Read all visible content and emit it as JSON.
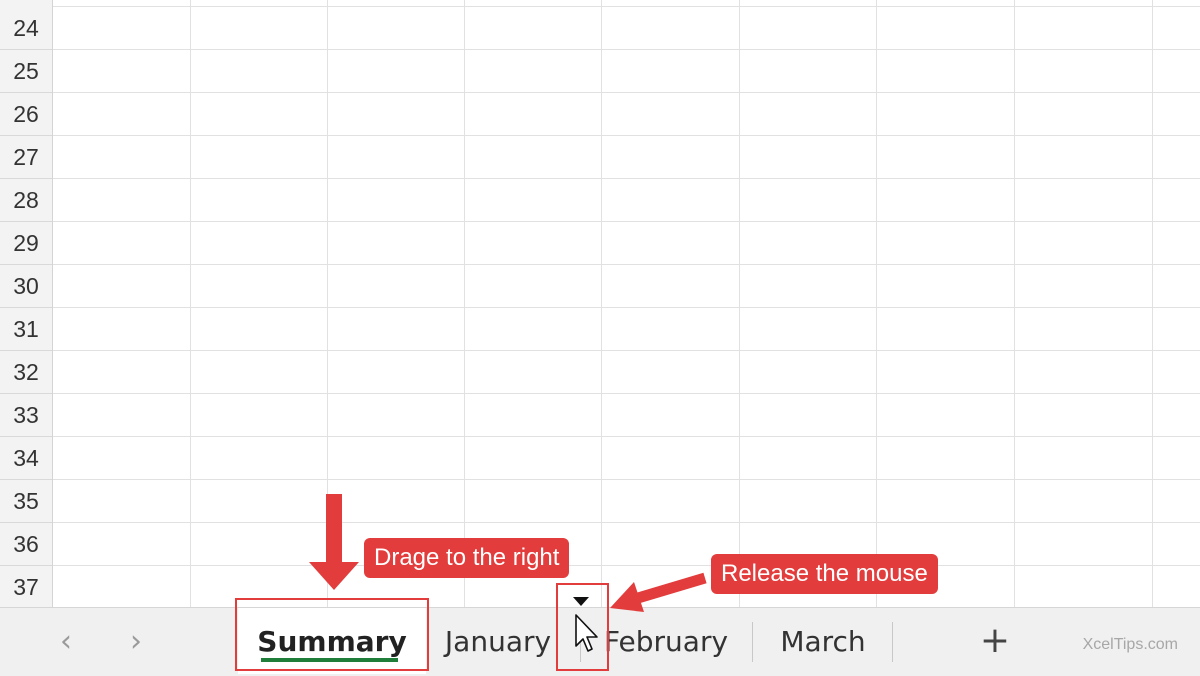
{
  "rows": [
    "24",
    "25",
    "26",
    "27",
    "28",
    "29",
    "30",
    "31",
    "32",
    "33",
    "34",
    "35",
    "36",
    "37"
  ],
  "sheet_tabs": {
    "nav_prev": "‹",
    "nav_next": "›",
    "tabs": [
      {
        "label": "Summary",
        "active": true
      },
      {
        "label": "January",
        "active": false
      },
      {
        "label": "February",
        "active": false
      },
      {
        "label": "March",
        "active": false
      }
    ],
    "add_sheet": "+"
  },
  "annotations": {
    "drag_label": "Drage to the right",
    "release_label": "Release the mouse",
    "accent_color": "#e23c3c"
  },
  "watermark": "XcelTips.com"
}
